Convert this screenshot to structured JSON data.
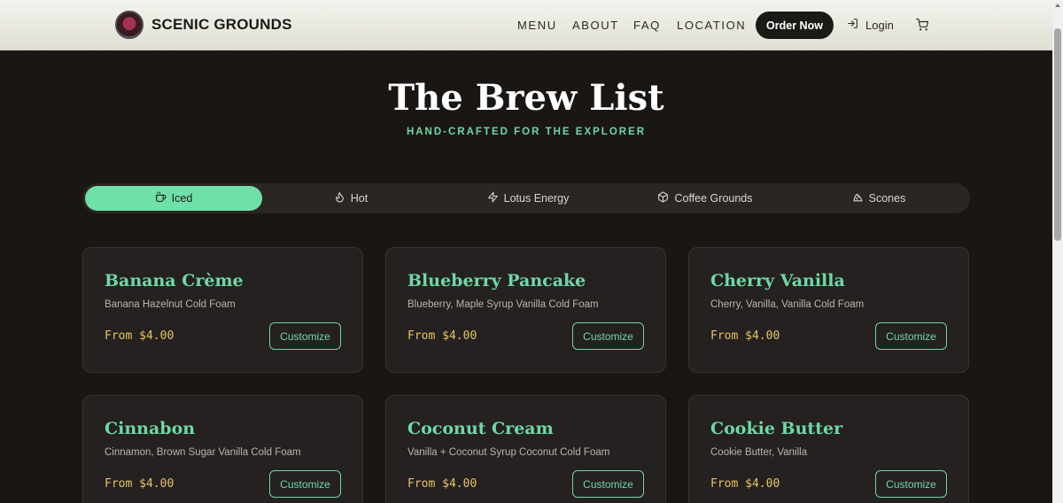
{
  "header": {
    "brand": "SCENIC GROUNDS",
    "nav": [
      "MENU",
      "ABOUT",
      "FAQ",
      "LOCATION"
    ],
    "order_label": "Order Now",
    "login_label": "Login",
    "logo_icon": "scenic-grounds-logo",
    "login_icon": "login-arrow-icon",
    "cart_icon": "cart-icon"
  },
  "hero": {
    "title": "The Brew List",
    "subtitle": "HAND-CRAFTED FOR THE EXPLORER"
  },
  "tabs": [
    {
      "label": "Iced",
      "icon": "iced-cup-icon",
      "active": true
    },
    {
      "label": "Hot",
      "icon": "flame-icon",
      "active": false
    },
    {
      "label": "Lotus Energy",
      "icon": "lightning-icon",
      "active": false
    },
    {
      "label": "Coffee Grounds",
      "icon": "box-icon",
      "active": false
    },
    {
      "label": "Scones",
      "icon": "scone-icon",
      "active": false
    }
  ],
  "cards": [
    {
      "name": "Banana Crème",
      "desc": "Banana Hazelnut Cold Foam",
      "price": "From $4.00",
      "button": "Customize"
    },
    {
      "name": "Blueberry Pancake",
      "desc": "Blueberry, Maple Syrup Vanilla Cold Foam",
      "price": "From $4.00",
      "button": "Customize"
    },
    {
      "name": "Cherry Vanilla",
      "desc": "Cherry, Vanilla, Vanilla Cold Foam",
      "price": "From $4.00",
      "button": "Customize"
    },
    {
      "name": "Cinnabon",
      "desc": "Cinnamon, Brown Sugar Vanilla Cold Foam",
      "price": "From $4.00",
      "button": "Customize"
    },
    {
      "name": "Coconut Cream",
      "desc": "Vanilla + Coconut Syrup Coconut Cold Foam",
      "price": "From $4.00",
      "button": "Customize"
    },
    {
      "name": "Cookie Butter",
      "desc": "Cookie Butter, Vanilla",
      "price": "From $4.00",
      "button": "Customize"
    }
  ],
  "colors": {
    "accent": "#6fd8a6",
    "price": "#e8c464",
    "background": "#1a1614",
    "card": "#242120"
  }
}
